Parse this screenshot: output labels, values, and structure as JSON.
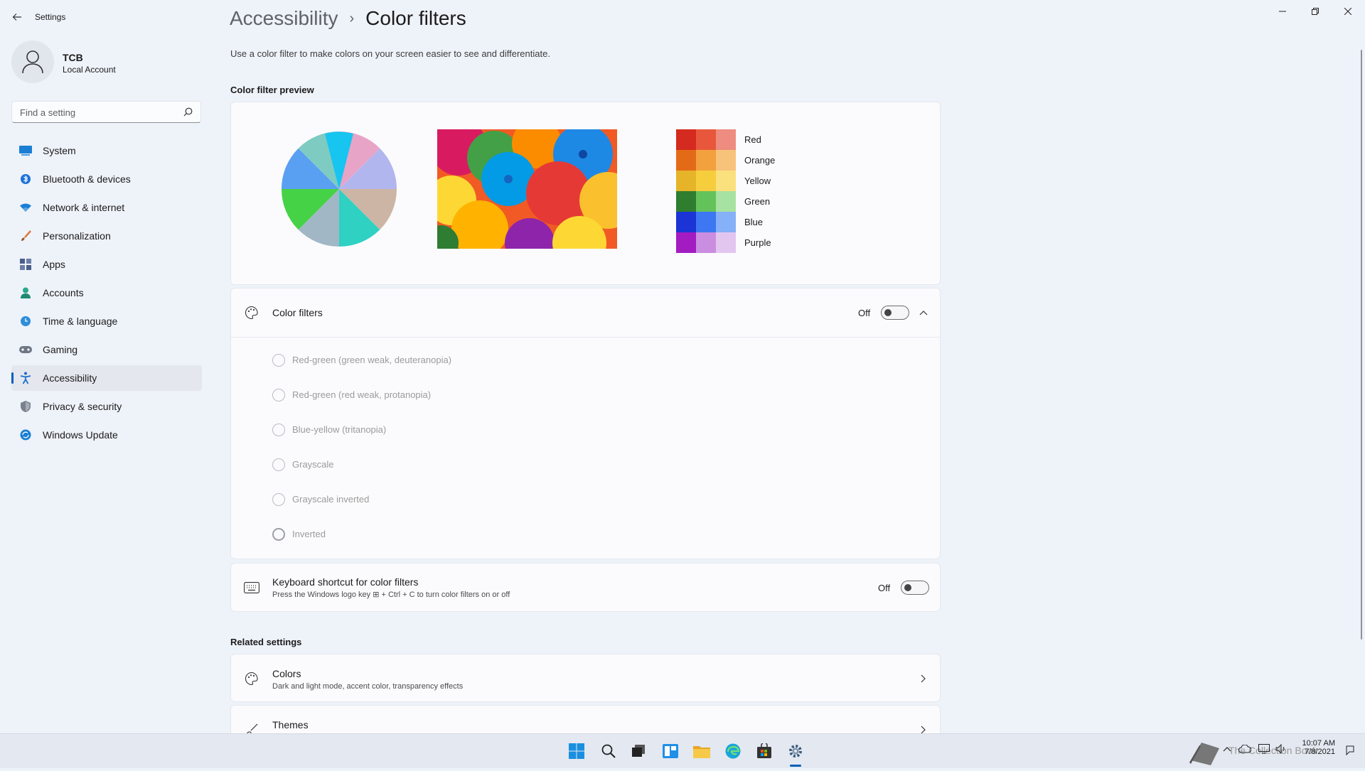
{
  "window": {
    "title": "Settings"
  },
  "profile": {
    "name": "TCB",
    "account_type": "Local Account"
  },
  "search": {
    "placeholder": "Find a setting"
  },
  "sidebar": {
    "items": [
      {
        "label": "System",
        "icon": "system-icon"
      },
      {
        "label": "Bluetooth & devices",
        "icon": "bluetooth-icon"
      },
      {
        "label": "Network & internet",
        "icon": "wifi-icon"
      },
      {
        "label": "Personalization",
        "icon": "brush-icon"
      },
      {
        "label": "Apps",
        "icon": "apps-icon"
      },
      {
        "label": "Accounts",
        "icon": "person-icon"
      },
      {
        "label": "Time & language",
        "icon": "globe-clock-icon"
      },
      {
        "label": "Gaming",
        "icon": "gamepad-icon"
      },
      {
        "label": "Accessibility",
        "icon": "accessibility-icon",
        "active": true
      },
      {
        "label": "Privacy & security",
        "icon": "shield-icon"
      },
      {
        "label": "Windows Update",
        "icon": "update-icon"
      }
    ]
  },
  "header": {
    "parent": "Accessibility",
    "separator": "›",
    "current": "Color filters"
  },
  "main": {
    "description": "Use a color filter to make colors on your screen easier to see and differentiate.",
    "preview_heading": "Color filter preview",
    "swatches": [
      {
        "label": "Red",
        "colors": [
          "#d42a1f",
          "#e8573b",
          "#ee8c7f"
        ]
      },
      {
        "label": "Orange",
        "colors": [
          "#e36b18",
          "#f2a13e",
          "#f7c27a"
        ]
      },
      {
        "label": "Yellow",
        "colors": [
          "#e6b429",
          "#f6cd3c",
          "#fbe07e"
        ]
      },
      {
        "label": "Green",
        "colors": [
          "#2f7d2e",
          "#64c25a",
          "#a8e2a0"
        ]
      },
      {
        "label": "Blue",
        "colors": [
          "#1c33d6",
          "#3d78f2",
          "#86b0f7"
        ]
      },
      {
        "label": "Purple",
        "colors": [
          "#a31cc2",
          "#c98ee0",
          "#e3c6ef"
        ]
      }
    ],
    "color_filters": {
      "label": "Color filters",
      "state": "Off",
      "options": [
        "Red-green (green weak, deuteranopia)",
        "Red-green (red weak, protanopia)",
        "Blue-yellow (tritanopia)",
        "Grayscale",
        "Grayscale inverted",
        "Inverted"
      ]
    },
    "shortcut": {
      "title": "Keyboard shortcut for color filters",
      "subtitle": "Press the Windows logo key ⊞ + Ctrl + C to turn color filters on or off",
      "state": "Off"
    },
    "related_heading": "Related settings",
    "related": [
      {
        "title": "Colors",
        "subtitle": "Dark and light mode, accent color, transparency effects"
      },
      {
        "title": "Themes"
      }
    ]
  },
  "taskbar": {
    "time": "10:07 AM",
    "date": "7/8/2021",
    "watermark": "The Collection Book"
  },
  "colors": {
    "accent": "#005fb8",
    "background": "#eef2f9"
  }
}
